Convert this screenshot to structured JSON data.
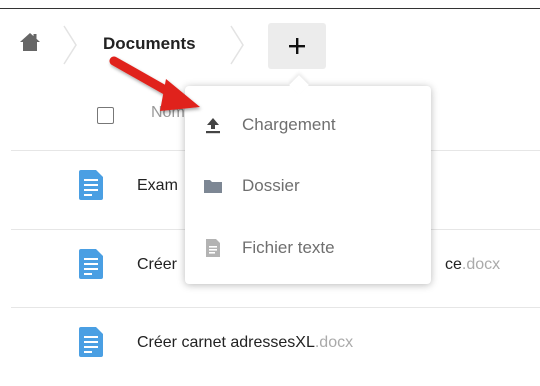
{
  "breadcrumb": {
    "home_icon": "home-icon",
    "current": "Documents",
    "new_button_symbol": "+"
  },
  "list": {
    "column_name": "Nom",
    "files": [
      {
        "name": "Exam",
        "ext": "",
        "trail": ""
      },
      {
        "name": "Créer",
        "ext": ".docx",
        "trail": "ce"
      },
      {
        "name": "Créer carnet adressesXL",
        "ext": ".docx",
        "trail": ""
      }
    ]
  },
  "new_menu": {
    "items": [
      {
        "label": "Chargement",
        "icon": "upload-icon"
      },
      {
        "label": "Dossier",
        "icon": "folder-icon"
      },
      {
        "label": "Fichier texte",
        "icon": "text-file-icon"
      }
    ]
  },
  "colors": {
    "file_icon": "#4a9fe3",
    "annotation_arrow": "#e0201a",
    "menu_icon": "#7d8794"
  }
}
